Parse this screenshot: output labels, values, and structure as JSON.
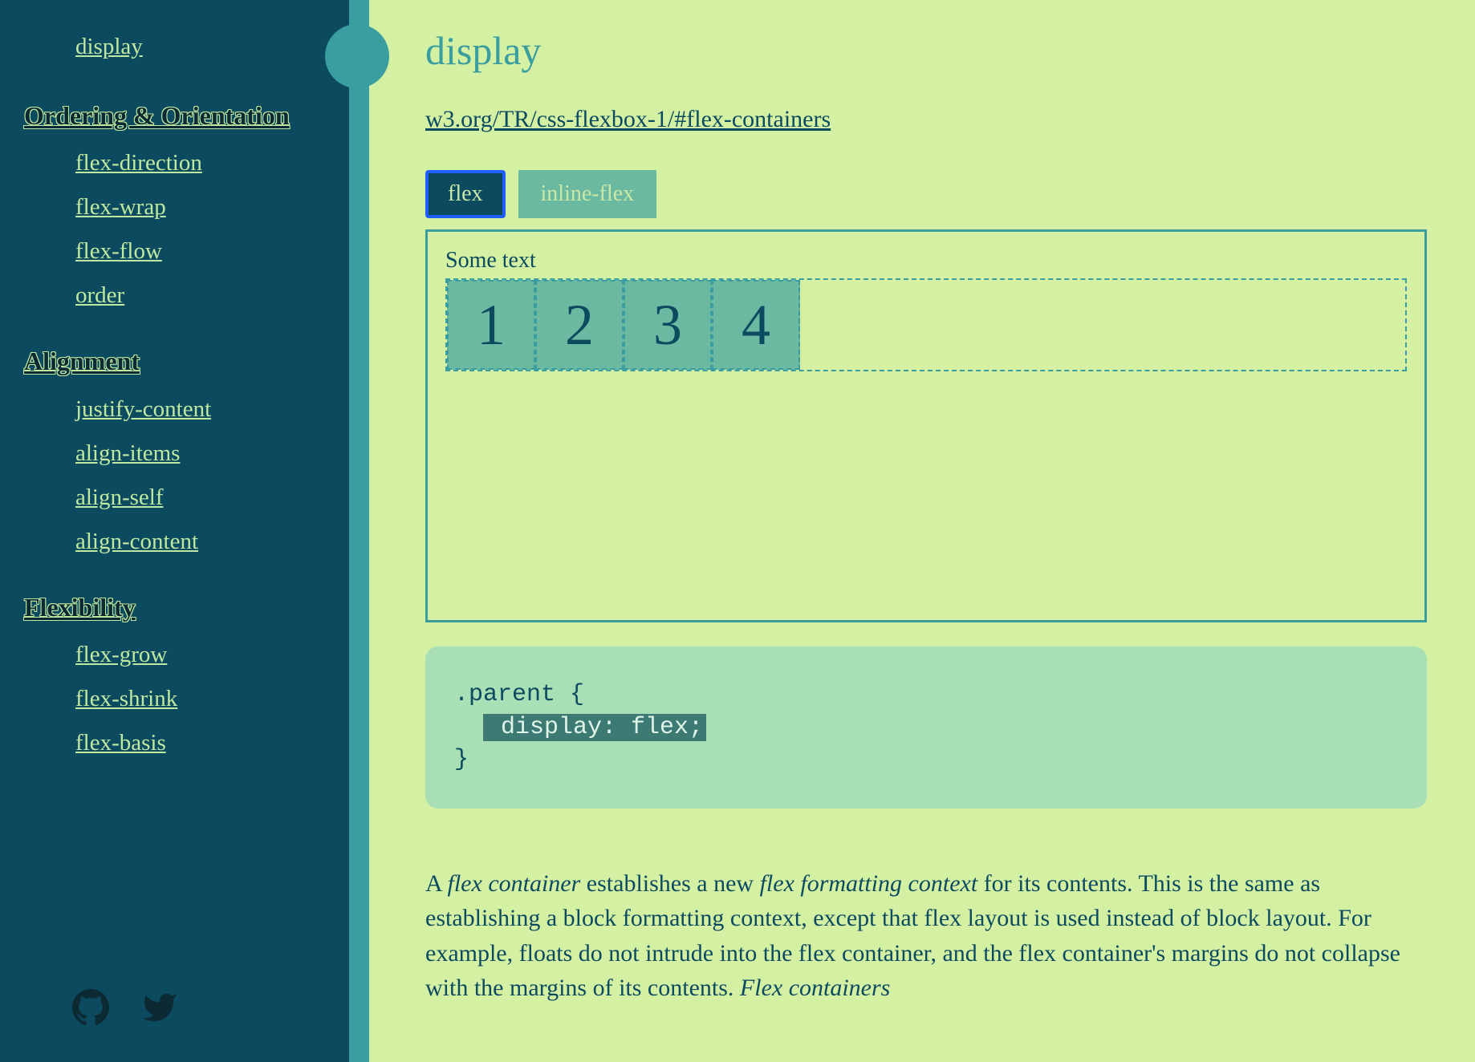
{
  "sidebar": {
    "top_link": "display",
    "sections": [
      {
        "heading": "Ordering & Orientation",
        "items": [
          "flex-direction",
          "flex-wrap",
          "flex-flow",
          "order"
        ]
      },
      {
        "heading": "Alignment",
        "items": [
          "justify-content",
          "align-items",
          "align-self",
          "align-content"
        ]
      },
      {
        "heading": "Flexibility",
        "items": [
          "flex-grow",
          "flex-shrink",
          "flex-basis"
        ]
      }
    ]
  },
  "page": {
    "title": "display",
    "spec_link": "w3.org/TR/css-flexbox-1/#flex-containers",
    "tabs": {
      "active": "flex",
      "inactive": "inline-flex"
    },
    "demo": {
      "label": "Some text",
      "items": [
        "1",
        "2",
        "3",
        "4"
      ]
    },
    "code": {
      "line1": ".parent {",
      "highlight": " display: flex;",
      "line3": "}"
    },
    "paragraph": {
      "t1": "A ",
      "i1": "flex container",
      "t2": " establishes a new ",
      "i2": "flex formatting context",
      "t3": " for its contents. This is the same as establishing a block formatting context, except that flex layout is used instead of block layout. For example, floats do not intrude into the flex container, and the flex container's margins do not collapse with the margins of its contents. ",
      "i3": "Flex containers"
    }
  }
}
